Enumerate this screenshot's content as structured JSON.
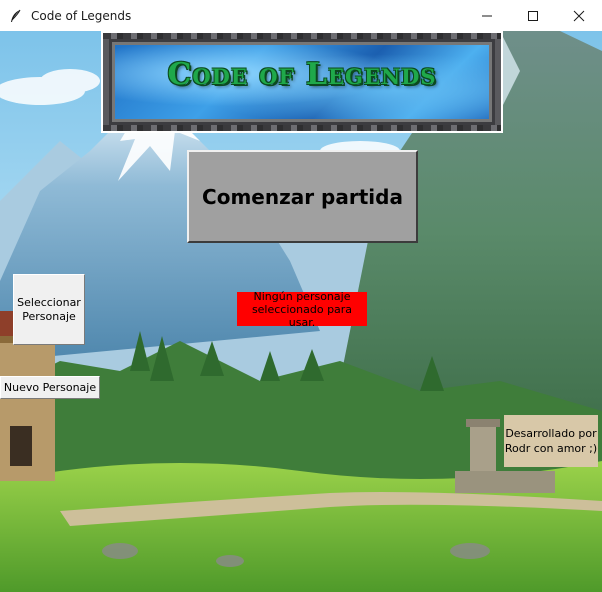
{
  "window": {
    "title": "Code of Legends",
    "icon": "feather-icon",
    "controls": [
      "minimize-icon",
      "maximize-icon",
      "close-icon"
    ]
  },
  "logo": {
    "text": "Code of Legends",
    "text_color": "#1fa84a",
    "background_color": "#2f86d8"
  },
  "buttons": {
    "start": "Comenzar partida",
    "select_character": "Seleccionar Personaje",
    "new_character": "Nuevo Personaje"
  },
  "status": {
    "text": "Ningún personaje seleccionado para usar.",
    "color": "#ff0000"
  },
  "credits": {
    "text": "Desarrollado por Rodr con amor ;)",
    "color": "#d8c8a8"
  },
  "colors": {
    "start_button": "#a0a0a0",
    "sky": "#8ecbea",
    "grass": "#7cc23a"
  }
}
